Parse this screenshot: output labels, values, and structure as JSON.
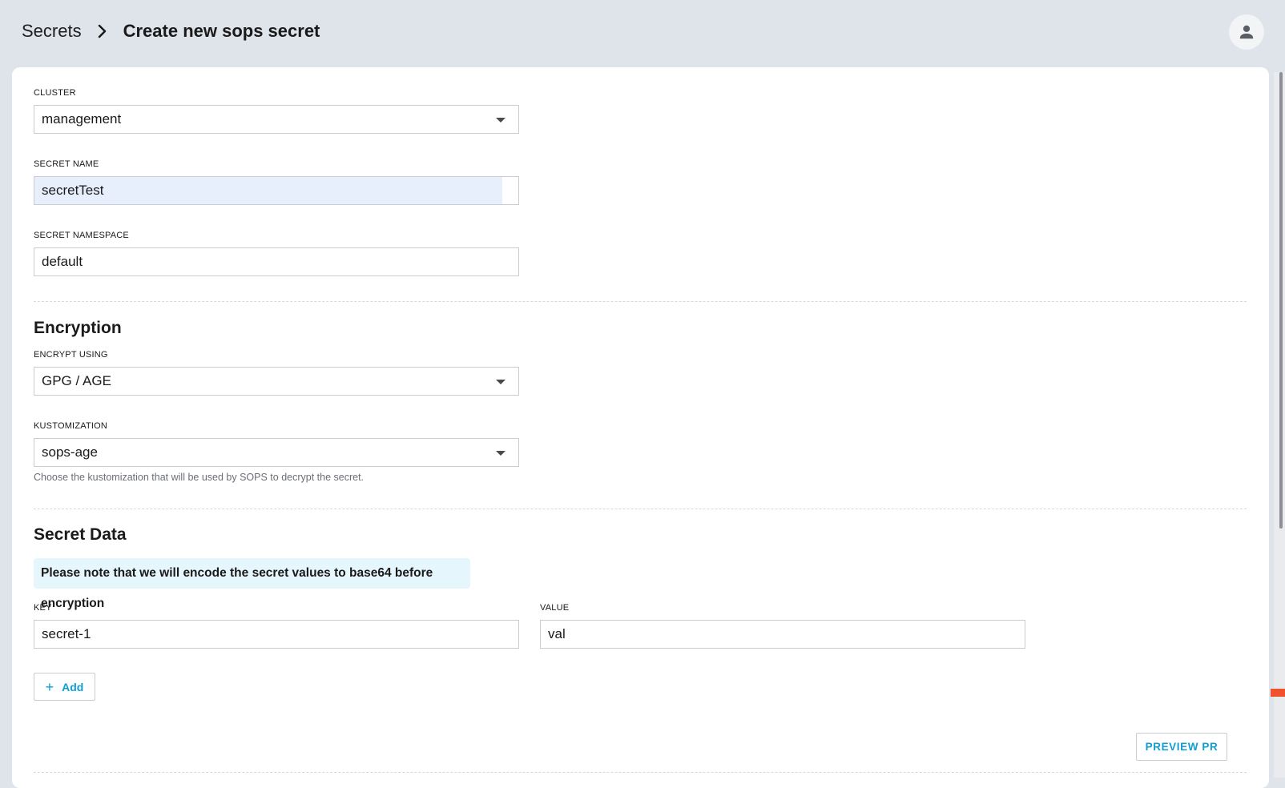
{
  "header": {
    "breadcrumb_parent": "Secrets",
    "breadcrumb_current": "Create new sops secret"
  },
  "form": {
    "cluster": {
      "label": "CLUSTER",
      "value": "management"
    },
    "secret_name": {
      "label": "SECRET NAME",
      "value": "secretTest"
    },
    "secret_namespace": {
      "label": "SECRET NAMESPACE",
      "value": "default"
    }
  },
  "encryption": {
    "title": "Encryption",
    "encrypt_using": {
      "label": "ENCRYPT USING",
      "value": "GPG / AGE"
    },
    "kustomization": {
      "label": "KUSTOMIZATION",
      "value": "sops-age",
      "helper": "Choose the kustomization that will be used by SOPS to decrypt the secret."
    }
  },
  "secret_data": {
    "title": "Secret Data",
    "notice": "Please note that we will encode the secret values to base64 before encryption",
    "key": {
      "label": "KEY",
      "value": "secret-1"
    },
    "value": {
      "label": "VALUE",
      "value": "val"
    },
    "add_label": "Add"
  },
  "actions": {
    "preview_label": "PREVIEW PR"
  },
  "colors": {
    "page_bg": "#dfe3ea",
    "accent": "#0f9fd1",
    "notice_bg": "#e6f6fd",
    "autofill_bg": "#e8effc"
  }
}
